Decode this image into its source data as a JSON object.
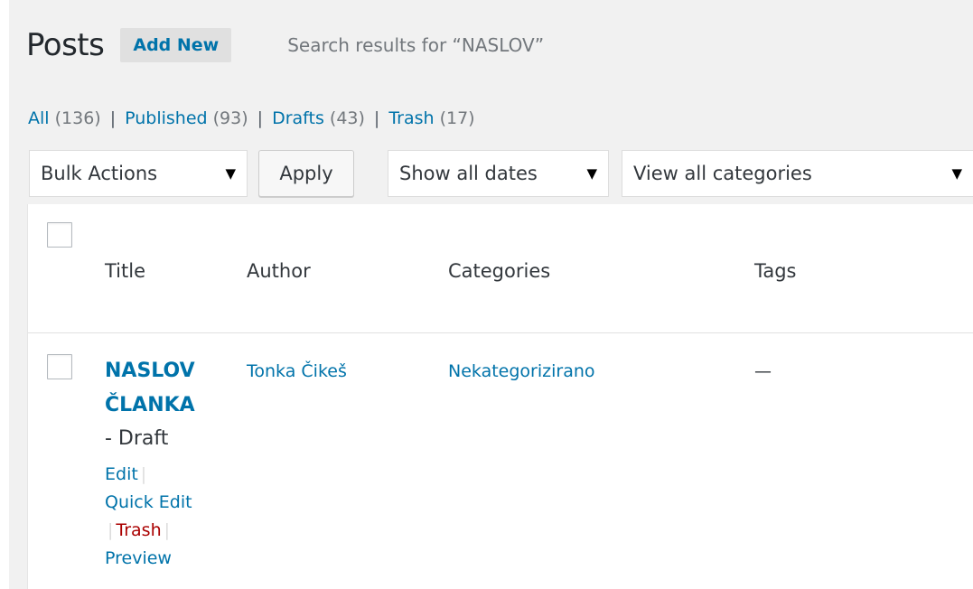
{
  "header": {
    "title": "Posts",
    "add_new": "Add New",
    "search_results": "Search results for “NASLOV”"
  },
  "filters": [
    {
      "label": "All",
      "count": "(136)"
    },
    {
      "label": "Published",
      "count": "(93)"
    },
    {
      "label": "Drafts",
      "count": "(43)"
    },
    {
      "label": "Trash",
      "count": "(17)"
    }
  ],
  "controls": {
    "bulk_actions": "Bulk Actions",
    "apply": "Apply",
    "dates": "Show all dates",
    "categories": "View all categories",
    "dropdown_glyph": "▼"
  },
  "columns": {
    "title": "Title",
    "author": "Author",
    "categories": "Categories",
    "tags": "Tags"
  },
  "rows": [
    {
      "title_line1": "NASLOV",
      "title_line2": "ČLANKA",
      "state": "- Draft",
      "actions": {
        "edit": "Edit",
        "quick_edit": "Quick Edit",
        "trash": "Trash",
        "preview": "Preview"
      },
      "author": "Tonka Čikeš",
      "categories": "Nekategorizirano",
      "tags": "—"
    }
  ],
  "colors": {
    "link": "#0073aa",
    "trash_link": "#aa0000",
    "background": "#f1f1f1"
  }
}
